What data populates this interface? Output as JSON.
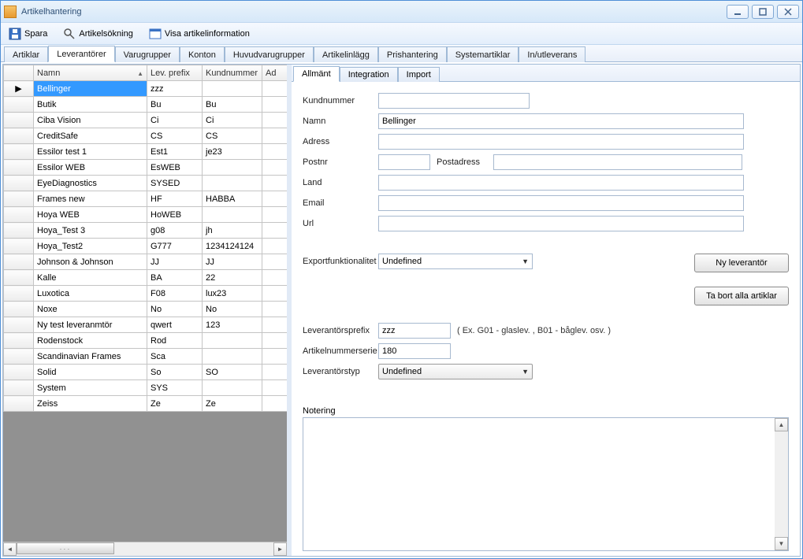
{
  "window": {
    "title": "Artikelhantering"
  },
  "toolbar": {
    "save": "Spara",
    "search": "Artikelsökning",
    "info": "Visa artikelinformation"
  },
  "main_tabs": [
    "Artiklar",
    "Leverantörer",
    "Varugrupper",
    "Konton",
    "Huvudvarugrupper",
    "Artikelinlägg",
    "Prishantering",
    "Systemartiklar",
    "In/utleverans"
  ],
  "main_tabs_active": 1,
  "grid": {
    "headers": [
      "Namn",
      "Lev. prefix",
      "Kundnummer",
      "Ad"
    ],
    "sort_col": 0,
    "rows": [
      {
        "namn": "Bellinger",
        "prefix": "zzz",
        "kund": "",
        "sel": true,
        "marker": "▶"
      },
      {
        "namn": "Butik",
        "prefix": "Bu",
        "kund": "Bu"
      },
      {
        "namn": "Ciba Vision",
        "prefix": "Ci",
        "kund": "Ci"
      },
      {
        "namn": "CreditSafe",
        "prefix": "CS",
        "kund": "CS"
      },
      {
        "namn": "Essilor test 1",
        "prefix": "Est1",
        "kund": "je23"
      },
      {
        "namn": "Essilor WEB",
        "prefix": "EsWEB",
        "kund": ""
      },
      {
        "namn": "EyeDiagnostics",
        "prefix": "SYSED",
        "kund": ""
      },
      {
        "namn": "Frames new",
        "prefix": "HF",
        "kund": "HABBA"
      },
      {
        "namn": "Hoya WEB",
        "prefix": "HoWEB",
        "kund": ""
      },
      {
        "namn": "Hoya_Test 3",
        "prefix": "g08",
        "kund": "jh"
      },
      {
        "namn": "Hoya_Test2",
        "prefix": "G777",
        "kund": "1234124124"
      },
      {
        "namn": "Johnson & Johnson",
        "prefix": "JJ",
        "kund": "JJ"
      },
      {
        "namn": "Kalle",
        "prefix": "BA",
        "kund": "22"
      },
      {
        "namn": "Luxotica",
        "prefix": "F08",
        "kund": "lux23"
      },
      {
        "namn": "Noxe",
        "prefix": "No",
        "kund": "No"
      },
      {
        "namn": "Ny test leveranmtör",
        "prefix": "qwert",
        "kund": "123"
      },
      {
        "namn": "Rodenstock",
        "prefix": "Rod",
        "kund": ""
      },
      {
        "namn": "Scandinavian Frames",
        "prefix": "Sca",
        "kund": ""
      },
      {
        "namn": "Solid",
        "prefix": "So",
        "kund": "SO"
      },
      {
        "namn": "System",
        "prefix": "SYS",
        "kund": ""
      },
      {
        "namn": "Zeiss",
        "prefix": "Ze",
        "kund": "Ze"
      }
    ]
  },
  "sub_tabs": [
    "Allmänt",
    "Integration",
    "Import"
  ],
  "sub_tabs_active": 0,
  "form": {
    "kundnummer_label": "Kundnummer",
    "kundnummer": "",
    "namn_label": "Namn",
    "namn": "Bellinger",
    "adress_label": "Adress",
    "adress": "",
    "postnr_label": "Postnr",
    "postnr": "",
    "postadress_label": "Postadress",
    "postadress": "",
    "land_label": "Land",
    "land": "",
    "email_label": "Email",
    "email": "",
    "url_label": "Url",
    "url": "",
    "export_label": "Exportfunktionalitet",
    "export_value": "Undefined",
    "prefix_label": "Leverantörsprefix",
    "prefix_value": "zzz",
    "prefix_hint": "( Ex. G01 - glaslev. , B01 - båglev. osv. )",
    "artserie_label": "Artikelnummerserie",
    "artserie_value": "180",
    "levtyp_label": "Leverantörstyp",
    "levtyp_value": "Undefined",
    "btn_new": "Ny leverantör",
    "btn_del": "Ta bort alla artiklar",
    "notering_label": "Notering"
  }
}
